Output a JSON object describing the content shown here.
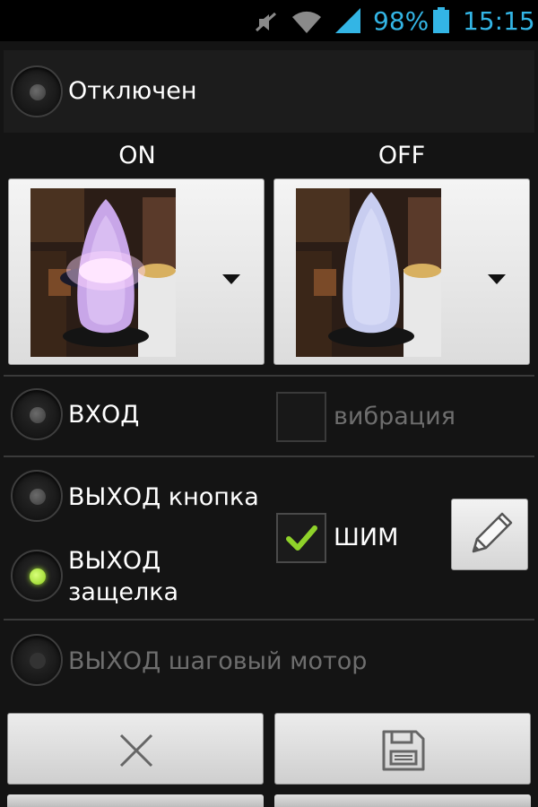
{
  "status_bar": {
    "battery_percent": "98%",
    "time": "15:15",
    "icons": [
      "mute-icon",
      "wifi-icon",
      "signal-icon",
      "battery-icon"
    ],
    "accent": "#33b5e5"
  },
  "mode_off": {
    "label": "Отключен",
    "selected": false
  },
  "images": {
    "on_label": "ON",
    "off_label": "OFF"
  },
  "input": {
    "label": "ВХОД",
    "selected": false,
    "vibration_label": "вибрация",
    "vibration_checked": false
  },
  "output": {
    "button_label": "ВЫХОД кнопка",
    "button_selected": false,
    "latch_line1": "ВЫХОД",
    "latch_line2": "защелка",
    "latch_selected": true,
    "pwm_label": "ШИМ",
    "pwm_checked": true
  },
  "stepper": {
    "label": "ВЫХОД шаговый мотор",
    "selected": false
  },
  "colors": {
    "radio_on": "#9bdc2a",
    "check": "#8fd22a"
  },
  "actions": {
    "cancel_icon": "close-icon",
    "save_icon": "save-icon"
  }
}
